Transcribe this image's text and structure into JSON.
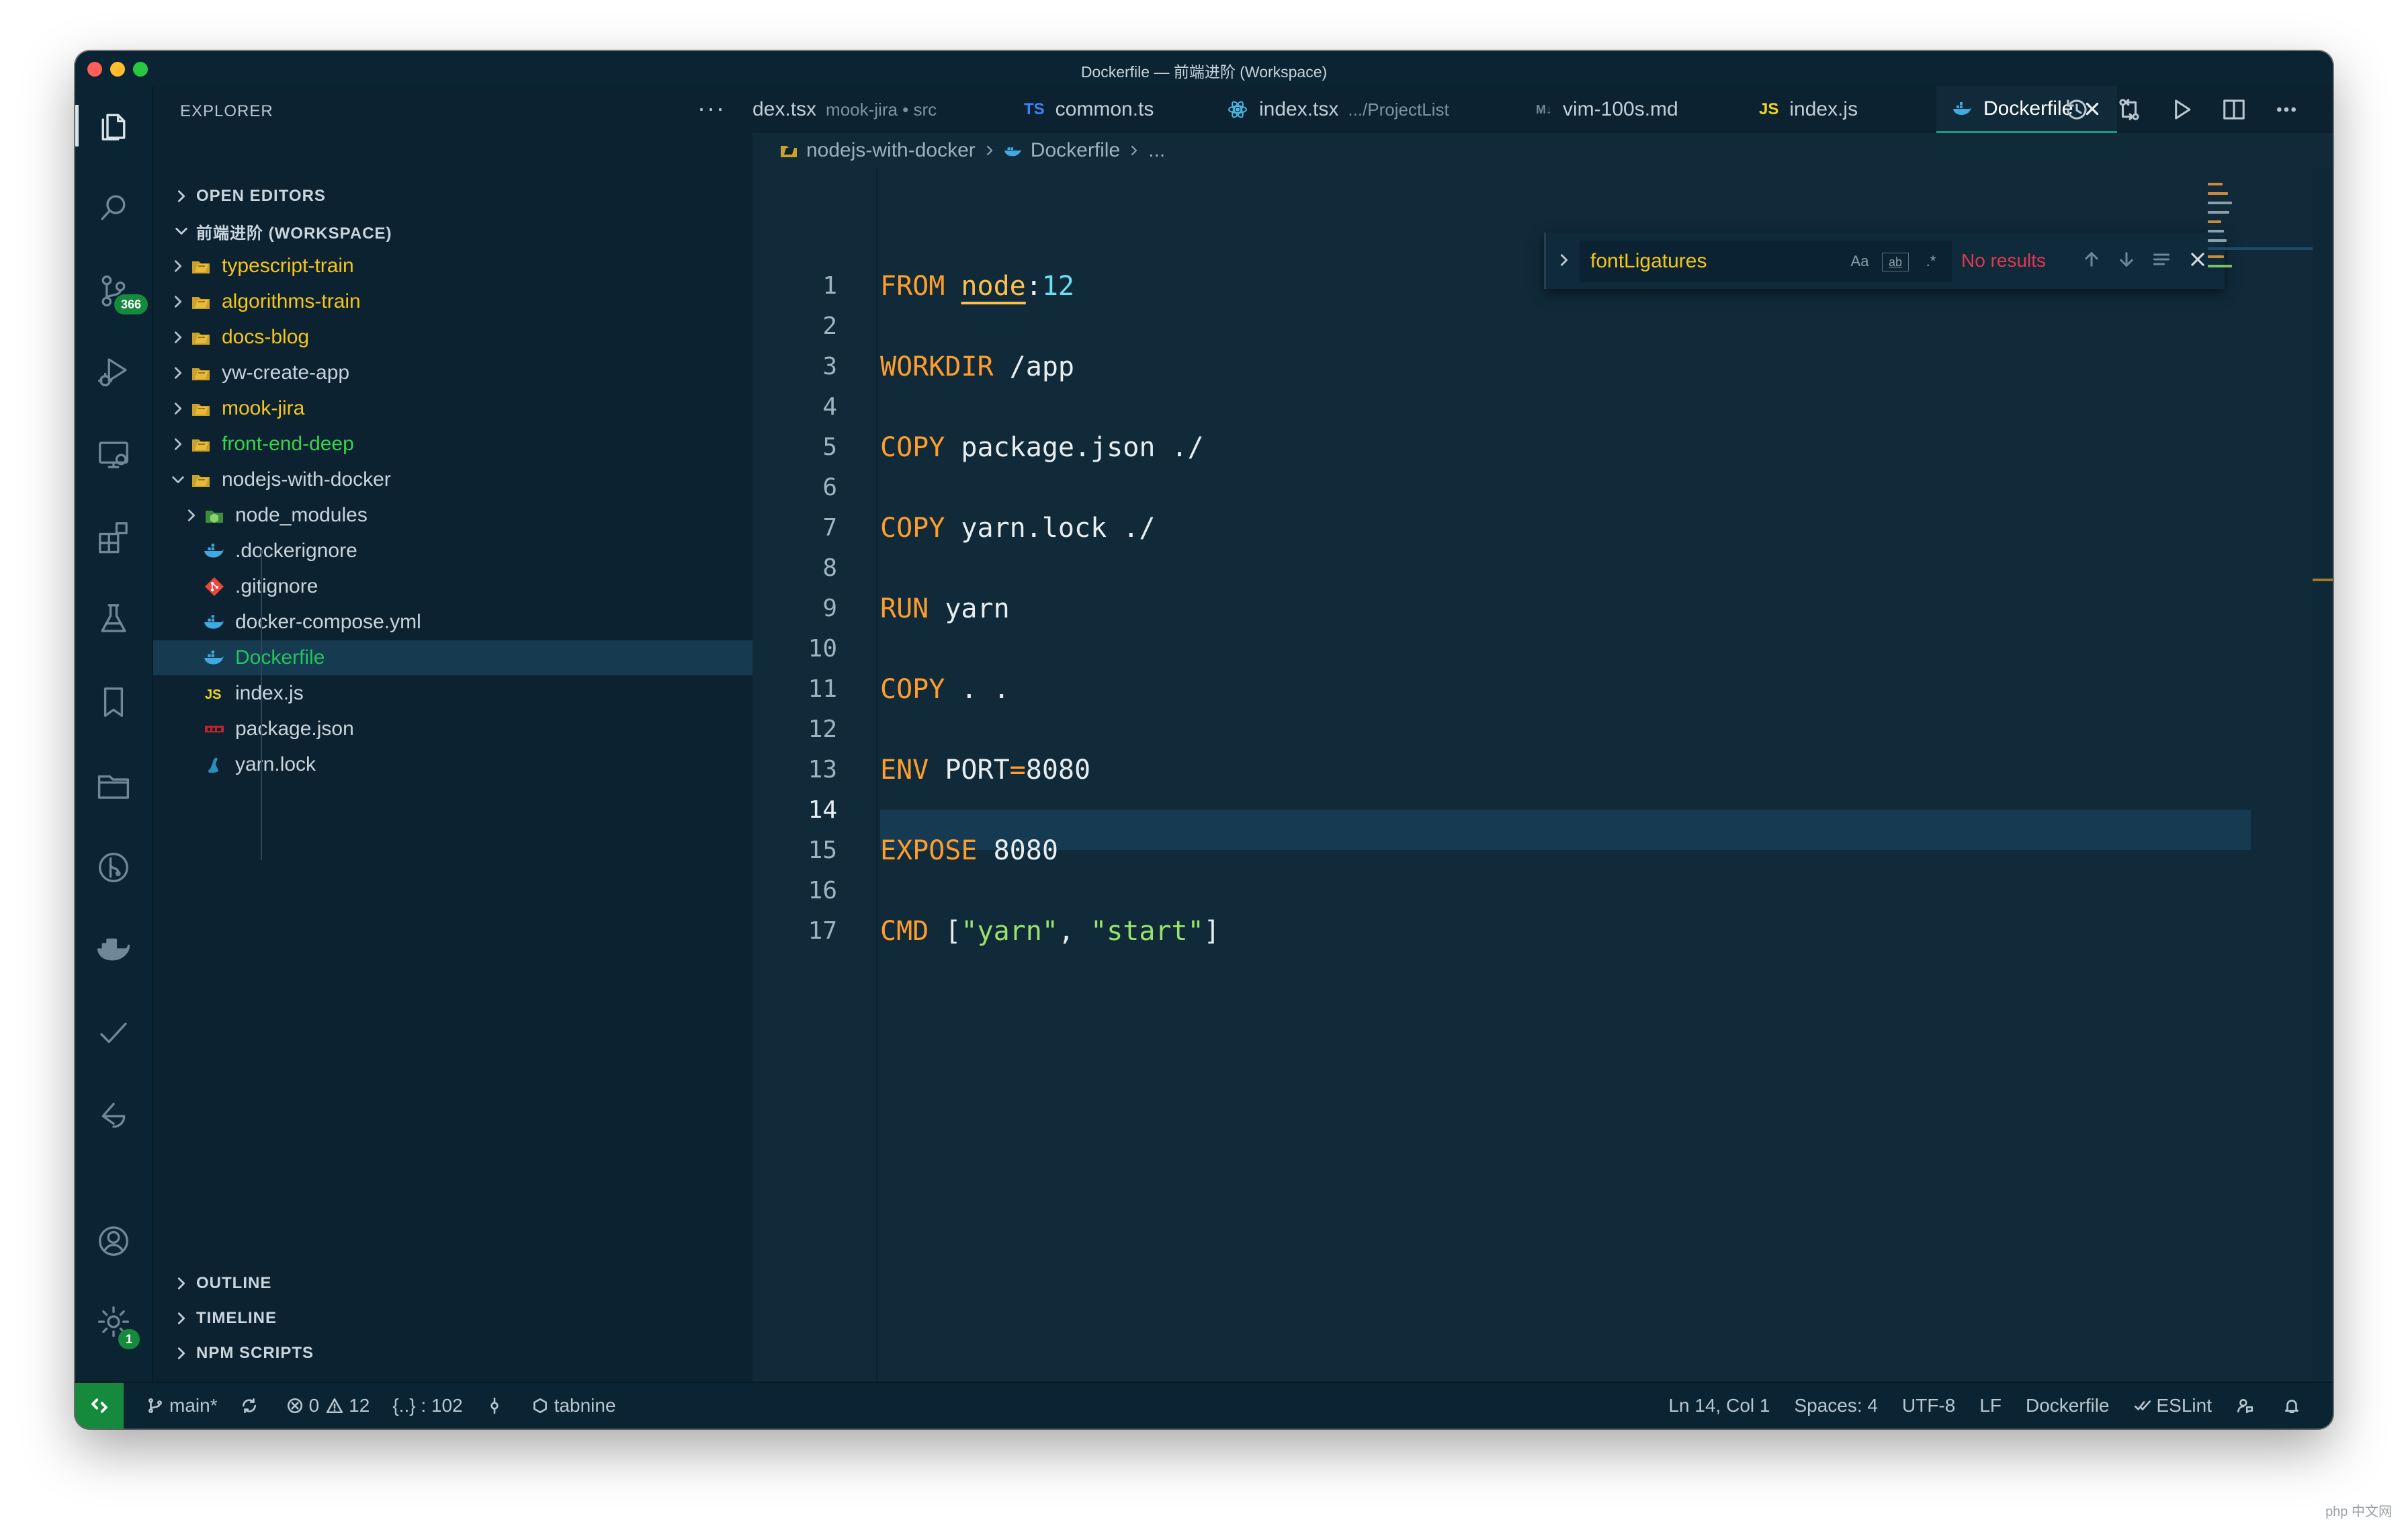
{
  "window": {
    "title": "Dockerfile — 前端进阶 (Workspace)"
  },
  "activity_bar": {
    "items": [
      {
        "name": "explorer-icon",
        "active": true
      },
      {
        "name": "search-icon"
      },
      {
        "name": "source-control-icon",
        "badge": "366"
      },
      {
        "name": "run-debug-icon"
      },
      {
        "name": "remote-explorer-icon"
      },
      {
        "name": "extensions-icon"
      },
      {
        "name": "testing-icon"
      },
      {
        "name": "bookmarks-icon"
      },
      {
        "name": "project-manager-icon"
      },
      {
        "name": "gitlens-icon"
      },
      {
        "name": "docker-icon"
      },
      {
        "name": "todo-check-icon"
      },
      {
        "name": "live-share-icon"
      }
    ],
    "bottom": [
      {
        "name": "accounts-icon"
      },
      {
        "name": "manage-gear-icon",
        "badge": "1"
      }
    ]
  },
  "sidebar": {
    "title": "EXPLORER",
    "more": "···",
    "open_editors": "OPEN EDITORS",
    "workspace": "前端进阶 (WORKSPACE)",
    "tree": [
      {
        "label": "typescript-train",
        "kind": "folder",
        "color": "#f5c518",
        "expanded": false
      },
      {
        "label": "algorithms-train",
        "kind": "folder",
        "color": "#f5c518",
        "expanded": false
      },
      {
        "label": "docs-blog",
        "kind": "folder",
        "color": "#f5c518",
        "expanded": false
      },
      {
        "label": "yw-create-app",
        "kind": "folder",
        "color": "#c9d4da",
        "expanded": false
      },
      {
        "label": "mook-jira",
        "kind": "folder",
        "color": "#f5c518",
        "expanded": false
      },
      {
        "label": "front-end-deep",
        "kind": "folder",
        "color": "#37d34a",
        "expanded": false
      },
      {
        "label": "nodejs-with-docker",
        "kind": "folder",
        "color": "#c9d4da",
        "expanded": true
      }
    ],
    "children": [
      {
        "label": "node_modules",
        "icon": "node-folder-icon",
        "folder": true
      },
      {
        "label": ".dockerignore",
        "icon": "docker-file-icon"
      },
      {
        "label": ".gitignore",
        "icon": "git-file-icon"
      },
      {
        "label": "docker-compose.yml",
        "icon": "docker-file-icon"
      },
      {
        "label": "Dockerfile",
        "icon": "docker-file-icon",
        "selected": true
      },
      {
        "label": "index.js",
        "icon": "js-file-icon",
        "icon_text": "JS"
      },
      {
        "label": "package.json",
        "icon": "npm-file-icon"
      },
      {
        "label": "yarn.lock",
        "icon": "yarn-file-icon"
      }
    ],
    "outline": "OUTLINE",
    "timeline": "TIMELINE",
    "npm_scripts": "NPM SCRIPTS"
  },
  "tabs": [
    {
      "label": "dex.tsx",
      "sub": "mook-jira • src",
      "icon": ""
    },
    {
      "label": "common.ts",
      "icon": "TS"
    },
    {
      "label": "index.tsx",
      "sub": ".../ProjectList",
      "icon": "react"
    },
    {
      "label": "vim-100s.md",
      "icon": "M↓"
    },
    {
      "label": "index.js",
      "icon": "JS"
    },
    {
      "label": "Dockerfile",
      "icon": "docker",
      "active": true
    }
  ],
  "breadcrumb": {
    "folder": "nodejs-with-docker",
    "file": "Dockerfile",
    "more": "..."
  },
  "find": {
    "value": "fontLigatures",
    "match_case": "Aa",
    "whole_word": "ab",
    "regex": ".*",
    "result": "No results"
  },
  "editor": {
    "current_line": 14,
    "lines": [
      {
        "n": "1",
        "tokens": [
          {
            "t": "FROM",
            "c": "kw"
          },
          {
            "t": " "
          },
          {
            "t": "node",
            "c": "img"
          },
          {
            "t": ":",
            "c": "punc"
          },
          {
            "t": "12",
            "c": "num"
          }
        ]
      },
      {
        "n": "2",
        "tokens": []
      },
      {
        "n": "3",
        "tokens": [
          {
            "t": "WORKDIR",
            "c": "kw"
          },
          {
            "t": " /app"
          }
        ]
      },
      {
        "n": "4",
        "tokens": []
      },
      {
        "n": "5",
        "tokens": [
          {
            "t": "COPY",
            "c": "kw"
          },
          {
            "t": " package.json ./"
          }
        ]
      },
      {
        "n": "6",
        "tokens": []
      },
      {
        "n": "7",
        "tokens": [
          {
            "t": "COPY",
            "c": "kw"
          },
          {
            "t": " yarn.lock ./"
          }
        ]
      },
      {
        "n": "8",
        "tokens": []
      },
      {
        "n": "9",
        "tokens": [
          {
            "t": "RUN",
            "c": "kw"
          },
          {
            "t": " yarn"
          }
        ]
      },
      {
        "n": "10",
        "tokens": []
      },
      {
        "n": "11",
        "tokens": [
          {
            "t": "COPY",
            "c": "kw"
          },
          {
            "t": " . ."
          }
        ]
      },
      {
        "n": "12",
        "tokens": []
      },
      {
        "n": "13",
        "tokens": [
          {
            "t": "ENV",
            "c": "kw"
          },
          {
            "t": " PORT"
          },
          {
            "t": "=",
            "c": "op"
          },
          {
            "t": "8080"
          }
        ]
      },
      {
        "n": "14",
        "tokens": []
      },
      {
        "n": "15",
        "tokens": [
          {
            "t": "EXPOSE",
            "c": "kw"
          },
          {
            "t": " 8080"
          }
        ]
      },
      {
        "n": "16",
        "tokens": []
      },
      {
        "n": "17",
        "tokens": [
          {
            "t": "CMD",
            "c": "kw"
          },
          {
            "t": " ["
          },
          {
            "t": "\"yarn\"",
            "c": "str"
          },
          {
            "t": ", "
          },
          {
            "t": "\"start\"",
            "c": "str"
          },
          {
            "t": "]"
          }
        ]
      }
    ]
  },
  "statusbar": {
    "branch": "main*",
    "errors": "0",
    "warnings": "12",
    "json_count": "{..} : 102",
    "tabnine": "tabnine",
    "position": "Ln 14, Col 1",
    "spaces": "Spaces: 4",
    "encoding": "UTF-8",
    "eol": "LF",
    "language": "Dockerfile",
    "eslint": "ESLint"
  },
  "watermark": "php 中文网",
  "colors": {
    "accent_green": "#168a3c",
    "keyword": "#ff9d2a",
    "string": "#9ae26a",
    "number": "#6ae0f0",
    "editor_bg": "#102a3a",
    "sidebar_bg": "#0c2231"
  }
}
